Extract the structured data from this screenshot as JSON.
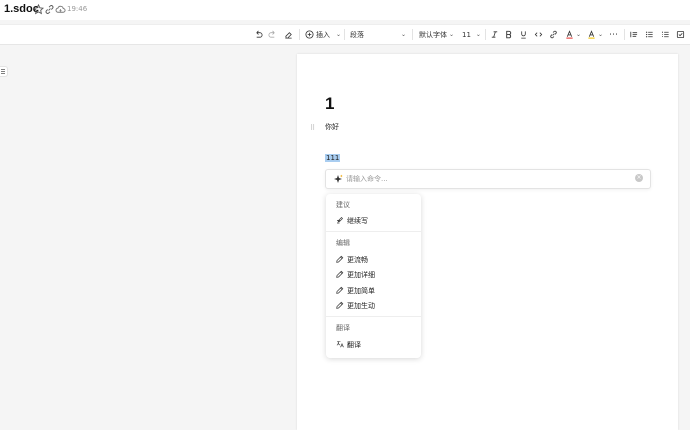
{
  "header": {
    "title": "1.sdoc",
    "time": "19:46"
  },
  "toolbar": {
    "insert_label": "插入",
    "paragraph_label": "段落",
    "font_label": "默认字体",
    "font_size": "11"
  },
  "document": {
    "heading": "1",
    "paragraph": "你好",
    "selected_text": "111"
  },
  "command": {
    "placeholder": "请输入命令..."
  },
  "menu": {
    "suggest_header": "建议",
    "continue_writing": "继续写",
    "edit_header": "编辑",
    "more_fluent": "更流畅",
    "more_detailed": "更加详细",
    "simpler": "更加简单",
    "more_vivid": "更加生动",
    "translate_header": "翻译",
    "translate": "翻译"
  },
  "colors": {
    "selection": "#a9cdf0",
    "text_color": "#e53935",
    "highlight": "#f2c200"
  }
}
